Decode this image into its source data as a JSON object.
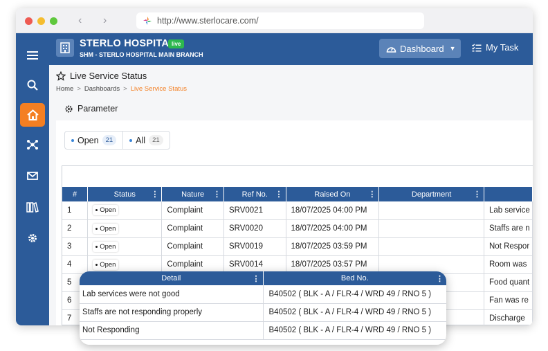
{
  "browser": {
    "url": "http://www.sterlocare.com/"
  },
  "header": {
    "hospital_name": "STERLO HOSPITAL",
    "live_badge": "live",
    "branch": "SHM - STERLO HOSPITAL MAIN BRANCH",
    "dashboard_label": "Dashboard",
    "mytask_label": "My Task"
  },
  "sidebar": {
    "items": [
      {
        "name": "menu",
        "icon": "hamburger-icon"
      },
      {
        "name": "search",
        "icon": "search-icon"
      },
      {
        "name": "home",
        "icon": "home-icon",
        "active": true
      },
      {
        "name": "network",
        "icon": "network-icon"
      },
      {
        "name": "mail",
        "icon": "mail-icon"
      },
      {
        "name": "library",
        "icon": "books-icon"
      },
      {
        "name": "settings",
        "icon": "gear-icon"
      }
    ]
  },
  "page": {
    "title": "Live Service Status",
    "breadcrumb": [
      "Home",
      "Dashboards",
      "Live Service Status"
    ],
    "breadcrumb_sep": ">",
    "parameter_label": "Parameter"
  },
  "tabs": [
    {
      "label": "Open",
      "count": "21"
    },
    {
      "label": "All",
      "count": "21"
    }
  ],
  "table": {
    "columns": [
      "#",
      "Status",
      "Nature",
      "Ref No.",
      "Raised On",
      "Department",
      ""
    ],
    "rows": [
      {
        "num": "1",
        "status": "Open",
        "nature": "Complaint",
        "ref": "SRV0021",
        "raised": "18/07/2025 04:00 PM",
        "department": "",
        "detail": "Lab service"
      },
      {
        "num": "2",
        "status": "Open",
        "nature": "Complaint",
        "ref": "SRV0020",
        "raised": "18/07/2025 04:00 PM",
        "department": "",
        "detail": "Staffs are n"
      },
      {
        "num": "3",
        "status": "Open",
        "nature": "Complaint",
        "ref": "SRV0019",
        "raised": "18/07/2025 03:59 PM",
        "department": "",
        "detail": "Not Respor"
      },
      {
        "num": "4",
        "status": "Open",
        "nature": "Complaint",
        "ref": "SRV0014",
        "raised": "18/07/2025 03:57 PM",
        "department": "",
        "detail": "Room was"
      },
      {
        "num": "5",
        "status": "",
        "nature": "",
        "ref": "",
        "raised": "",
        "department": "",
        "detail": "Food quant"
      },
      {
        "num": "6",
        "status": "",
        "nature": "",
        "ref": "",
        "raised": "",
        "department": "",
        "detail": "Fan was re"
      },
      {
        "num": "7",
        "status": "",
        "nature": "",
        "ref": "",
        "raised": "",
        "department": "",
        "detail": "Discharge"
      }
    ]
  },
  "popup": {
    "columns": [
      "Detail",
      "Bed No."
    ],
    "rows": [
      {
        "detail": "Lab services were not good",
        "bed": "B40502 ( BLK - A / FLR-4 / WRD 49 / RNO 5 )"
      },
      {
        "detail": "Staffs are not responding properly",
        "bed": "B40502 ( BLK - A / FLR-4 / WRD 49 / RNO 5 )"
      },
      {
        "detail": "Not Responding",
        "bed": "B40502 ( BLK - A / FLR-4 / WRD 49 / RNO 5 )"
      }
    ]
  },
  "colors": {
    "primary": "#2c5b99",
    "accent": "#f47f22",
    "live": "#2db84d"
  }
}
